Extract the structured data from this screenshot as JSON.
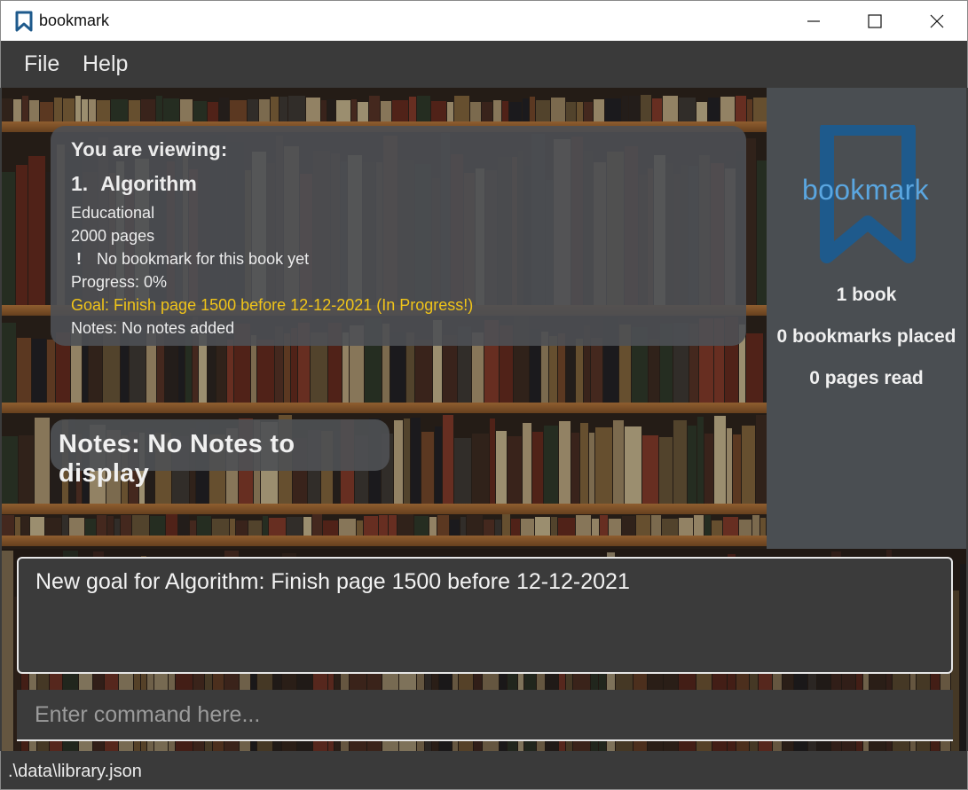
{
  "window": {
    "title": "bookmark",
    "app_icon": "bookmark-icon",
    "controls": [
      "minimize-icon",
      "maximize-icon",
      "close-icon"
    ]
  },
  "menu": {
    "file": "File",
    "help": "Help"
  },
  "viewing": {
    "heading": "You are viewing:",
    "index": "1.",
    "title": "Algorithm",
    "genre": "Educational",
    "pages": "2000 pages",
    "bookmark_icon": "!",
    "bookmark": "No bookmark for this book yet",
    "progress": "Progress: 0%",
    "goal": "Goal: Finish page 1500 before 12-12-2021 (In Progress!)",
    "notes": "Notes: No notes added"
  },
  "notes_panel": {
    "text": "Notes: No Notes to display"
  },
  "sidebar": {
    "logo_text": "bookmark",
    "books": "1 book",
    "bookmarks": "0 bookmarks placed",
    "pages_read": "0 pages read"
  },
  "result": {
    "text": "New goal for Algorithm: Finish page 1500 before 12-12-2021"
  },
  "command": {
    "placeholder": "Enter command here...",
    "value": ""
  },
  "status": {
    "path": ".\\data\\library.json"
  },
  "colors": {
    "goal_text": "#f0c419",
    "logo_blue": "#1e5a8c",
    "logo_text_blue": "#5aa6e0",
    "card_bg": "#4e5054",
    "sidebar_bg": "#4a4e52"
  }
}
